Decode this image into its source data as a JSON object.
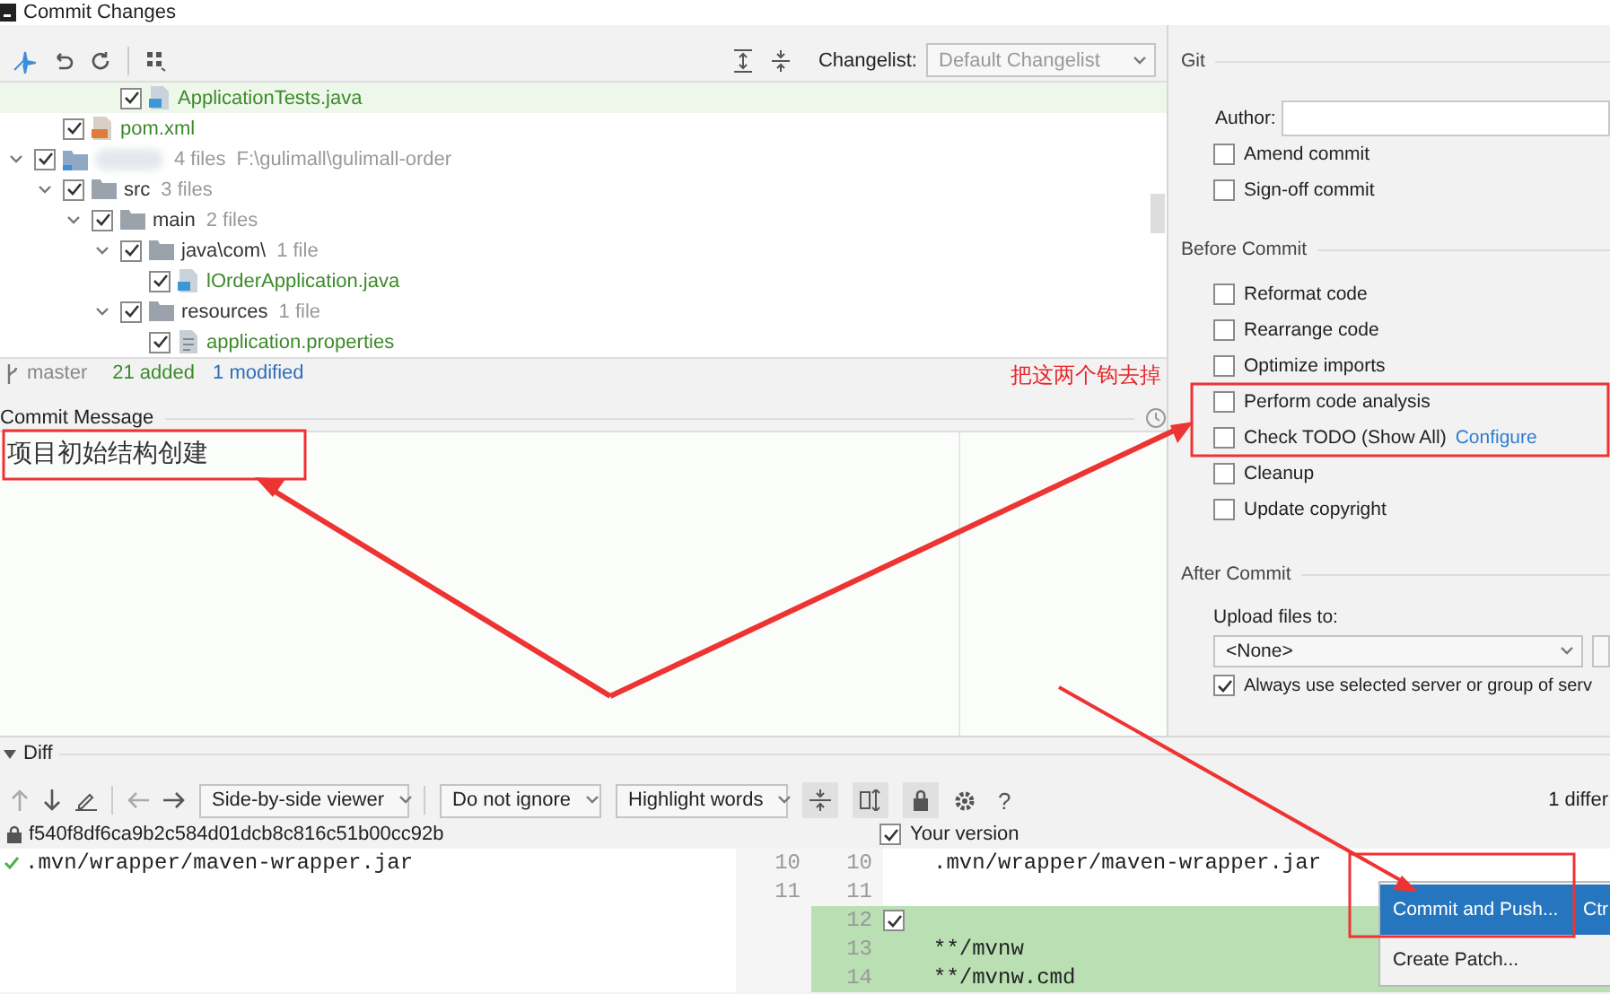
{
  "window": {
    "title": "Commit Changes"
  },
  "toolbar": {
    "changelist_label": "Changelist:",
    "changelist": "Default Changelist"
  },
  "tree": [
    {
      "kind": "offscreen",
      "children": [
        {
          "kind": "offscreen",
          "children": [
            {
              "kind": "offscreen",
              "children": [
                {
                  "kind": "java",
                  "name": "ApplicationTests.java",
                  "color": "#3d8a2c",
                  "checked": true,
                  "selected": true
                }
              ]
            }
          ]
        },
        {
          "kind": "xml",
          "name": "pom.xml",
          "color": "#3d8a2c",
          "checked": true,
          "selected": false
        }
      ]
    },
    {
      "kind": "module",
      "count": "4 files",
      "path": "F:\\gulimall\\gulimall-order",
      "checked": true,
      "expanded": true,
      "selected": false,
      "children": [
        {
          "kind": "folder",
          "name": "src",
          "count": "3 files",
          "checked": true,
          "expanded": true,
          "selected": false,
          "children": [
            {
              "kind": "folder",
              "name": "main",
              "count": "2 files",
              "checked": true,
              "expanded": true,
              "selected": false,
              "children": [
                {
                  "kind": "folder",
                  "name": "java\\com\\",
                  "count": "1 file",
                  "checked": true,
                  "expanded": true,
                  "selected": false,
                  "children": [
                    {
                      "kind": "java",
                      "name": "lOrderApplication.java",
                      "color": "#3d8a2c",
                      "checked": true,
                      "selected": false
                    }
                  ]
                },
                {
                  "kind": "folder",
                  "name": "resources",
                  "count": "1 file",
                  "checked": true,
                  "expanded": true,
                  "selected": false,
                  "children": [
                    {
                      "kind": "properties",
                      "name": "application.properties",
                      "color": "#3d8a2c",
                      "checked": true,
                      "selected": false
                    }
                  ]
                }
              ]
            }
          ]
        }
      ]
    }
  ],
  "status_bar": {
    "branch": "master",
    "added": "21 added",
    "modified": "1 modified"
  },
  "commit_message": {
    "label": "Commit Message",
    "value": "项目初始结构创建"
  },
  "git": {
    "title": "Git",
    "author_label": "Author:",
    "options": [
      {
        "label": "Amend commit",
        "checked": false
      },
      {
        "label": "Sign-off commit",
        "checked": false
      }
    ]
  },
  "before_commit": {
    "title": "Before Commit",
    "options": [
      {
        "label": "Reformat code",
        "checked": false
      },
      {
        "label": "Rearrange code",
        "checked": false
      },
      {
        "label": "Optimize imports",
        "checked": false
      },
      {
        "label": "Perform code analysis",
        "checked": false
      },
      {
        "label": "Check TODO (Show All)",
        "checked": false,
        "link": "Configure"
      },
      {
        "label": "Cleanup",
        "checked": false
      },
      {
        "label": "Update copyright",
        "checked": false
      }
    ]
  },
  "after_commit": {
    "title": "After Commit",
    "upload_label": "Upload files to:",
    "server": "<None>",
    "options": [
      {
        "label": "Always use selected server or group of serv",
        "checked": true
      }
    ]
  },
  "diff": {
    "title": "Diff",
    "viewer": "Side-by-side viewer",
    "ignore": "Do not ignore",
    "highlight": "Highlight words",
    "help": "?",
    "differences": "1 differ",
    "left_title": "f540f8df6ca9b2c584d01dcb8c816c51b00cc92b",
    "right_title": "Your version",
    "right_checked": true,
    "lines": [
      {
        "left_num": "10",
        "right_num": "10",
        "left_text": ".mvn/wrapper/maven-wrapper.jar",
        "right_text": ".mvn/wrapper/maven-wrapper.jar",
        "added": false,
        "resolved": true
      },
      {
        "left_num": "11",
        "right_num": "11",
        "added": false,
        "resolved": false
      },
      {
        "right_num": "12",
        "added": true,
        "resolved": false,
        "checkbox": {
          "checked": true
        }
      },
      {
        "right_num": "13",
        "right_text": "**/mvnw",
        "added": true,
        "resolved": false
      },
      {
        "right_num": "14",
        "right_text": "**/mvnw.cmd",
        "added": true,
        "resolved": false
      }
    ]
  },
  "popup_menu": [
    {
      "label": "Commit and Push...",
      "shortcut": "Ctr",
      "selected": true
    },
    {
      "label": "Create Patch...",
      "selected": false
    }
  ],
  "annotation": {
    "note": "把这两个钩去掉"
  }
}
